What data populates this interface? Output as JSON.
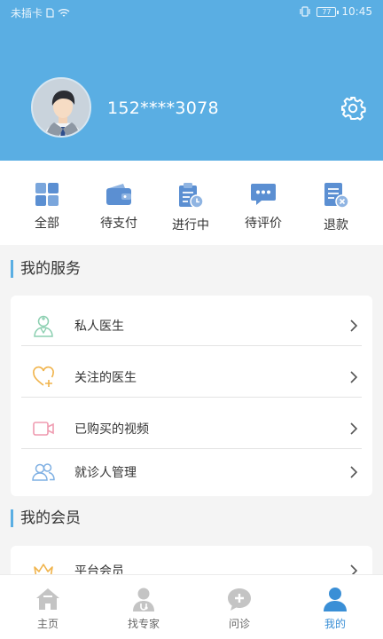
{
  "status_bar": {
    "carrier": "未插卡",
    "battery": "77",
    "time": "10:45"
  },
  "profile": {
    "phone": "152****3078"
  },
  "orders": [
    {
      "label": "全部",
      "icon": "grid-icon"
    },
    {
      "label": "待支付",
      "icon": "wallet-icon"
    },
    {
      "label": "进行中",
      "icon": "clipboard-clock-icon"
    },
    {
      "label": "待评价",
      "icon": "chat-bubble-icon"
    },
    {
      "label": "退款",
      "icon": "document-cancel-icon"
    }
  ],
  "services": {
    "title": "我的服务",
    "items": [
      {
        "label": "私人医生",
        "icon": "doctor-icon"
      },
      {
        "label": "关注的医生",
        "icon": "heart-plus-icon"
      },
      {
        "label": "已购买的视频",
        "icon": "video-icon"
      },
      {
        "label": "就诊人管理",
        "icon": "people-icon"
      }
    ]
  },
  "membership": {
    "title": "我的会员",
    "items": [
      {
        "label": "平台会员",
        "icon": "crown-icon"
      }
    ]
  },
  "tabbar": [
    {
      "label": "主页",
      "icon": "home-icon",
      "active": false
    },
    {
      "label": "找专家",
      "icon": "expert-icon",
      "active": false
    },
    {
      "label": "问诊",
      "icon": "consult-icon",
      "active": false
    },
    {
      "label": "我的",
      "icon": "person-icon",
      "active": true
    }
  ],
  "colors": {
    "header": "#5aaee3",
    "accent": "#3a8fd6",
    "icon_blue": "#5b9bd9"
  }
}
